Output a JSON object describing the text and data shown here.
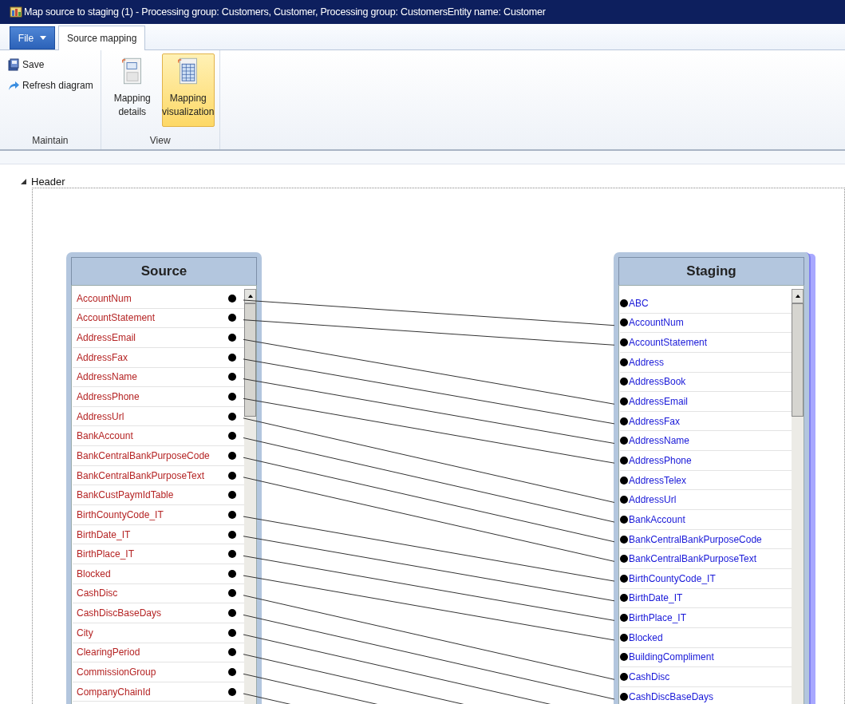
{
  "window": {
    "title": "Map source to staging (1) - Processing group: Customers, Customer, Processing group: CustomersEntity name: Customer"
  },
  "file_menu": {
    "label": "File"
  },
  "tabs": [
    {
      "label": "Source mapping",
      "selected": true
    }
  ],
  "ribbon": {
    "groups": [
      {
        "label": "Maintain",
        "kind": "small",
        "buttons": [
          {
            "label": "Save",
            "kind": "save",
            "selected": false
          },
          {
            "label": "Refresh diagram",
            "kind": "refresh",
            "selected": false
          }
        ]
      },
      {
        "label": "View",
        "kind": "large",
        "buttons": [
          {
            "label": "Mapping details",
            "kind": "details",
            "selected": false
          },
          {
            "label": "Mapping visualization",
            "kind": "visualization",
            "selected": true
          }
        ]
      }
    ]
  },
  "section": {
    "label": "Header",
    "expanded": true
  },
  "source": {
    "title": "Source",
    "items": [
      {
        "name": "AccountNum",
        "connected": true
      },
      {
        "name": "AccountStatement",
        "connected": true
      },
      {
        "name": "AddressEmail",
        "connected": true
      },
      {
        "name": "AddressFax",
        "connected": true
      },
      {
        "name": "AddressName",
        "connected": true
      },
      {
        "name": "AddressPhone",
        "connected": true
      },
      {
        "name": "AddressUrl",
        "connected": true
      },
      {
        "name": "BankAccount",
        "connected": true
      },
      {
        "name": "BankCentralBankPurposeCode",
        "connected": true
      },
      {
        "name": "BankCentralBankPurposeText",
        "connected": true
      },
      {
        "name": "BankCustPaymIdTable",
        "connected": false
      },
      {
        "name": "BirthCountyCode_IT",
        "connected": true
      },
      {
        "name": "BirthDate_IT",
        "connected": true
      },
      {
        "name": "BirthPlace_IT",
        "connected": true
      },
      {
        "name": "Blocked",
        "connected": true
      },
      {
        "name": "CashDisc",
        "connected": true
      },
      {
        "name": "CashDiscBaseDays",
        "connected": true
      },
      {
        "name": "City",
        "connected": true
      },
      {
        "name": "ClearingPeriod",
        "connected": true
      },
      {
        "name": "CommissionGroup",
        "connected": true
      },
      {
        "name": "CompanyChainId",
        "connected": true
      }
    ]
  },
  "staging": {
    "title": "Staging",
    "items": [
      {
        "name": "ABC",
        "connected": false
      },
      {
        "name": "AccountNum",
        "connected": true
      },
      {
        "name": "AccountStatement",
        "connected": true
      },
      {
        "name": "Address",
        "connected": false
      },
      {
        "name": "AddressBook",
        "connected": false
      },
      {
        "name": "AddressEmail",
        "connected": true
      },
      {
        "name": "AddressFax",
        "connected": true
      },
      {
        "name": "AddressName",
        "connected": true
      },
      {
        "name": "AddressPhone",
        "connected": true
      },
      {
        "name": "AddressTelex",
        "connected": false
      },
      {
        "name": "AddressUrl",
        "connected": true
      },
      {
        "name": "BankAccount",
        "connected": true
      },
      {
        "name": "BankCentralBankPurposeCode",
        "connected": true
      },
      {
        "name": "BankCentralBankPurposeText",
        "connected": true
      },
      {
        "name": "BirthCountyCode_IT",
        "connected": true
      },
      {
        "name": "BirthDate_IT",
        "connected": true
      },
      {
        "name": "BirthPlace_IT",
        "connected": true
      },
      {
        "name": "Blocked",
        "connected": true
      },
      {
        "name": "BuildingCompliment",
        "connected": false
      },
      {
        "name": "CashDisc",
        "connected": true
      },
      {
        "name": "CashDiscBaseDays",
        "connected": true
      }
    ]
  }
}
